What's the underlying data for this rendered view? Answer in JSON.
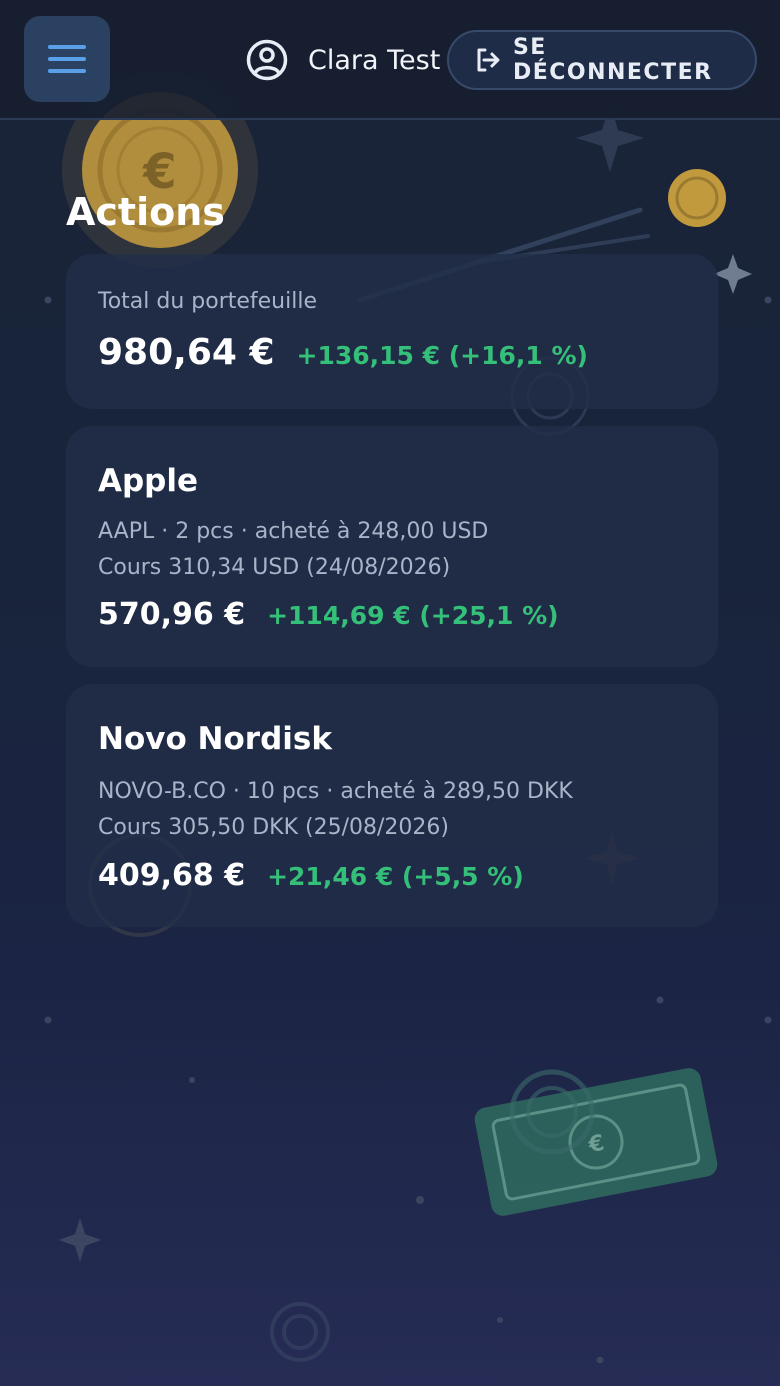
{
  "header": {
    "user_name": "Clara Test",
    "logout_label": "SE DÉCONNECTER"
  },
  "page": {
    "title": "Actions"
  },
  "portfolio": {
    "total_label": "Total du portefeuille",
    "total_value": "980,64 €",
    "total_change": "+136,15 € (+16,1 %)"
  },
  "holdings": [
    {
      "name": "Apple",
      "details": "AAPL · 2 pcs · acheté à 248,00 USD",
      "price": "Cours 310,34 USD (24/08/2026)",
      "value": "570,96 €",
      "change": "+114,69 € (+25,1 %)"
    },
    {
      "name": "Novo Nordisk",
      "details": "NOVO-B.CO · 10 pcs · acheté à 289,50 DKK",
      "price": "Cours 305,50 DKK (25/08/2026)",
      "value": "409,68 €",
      "change": "+21,46 € (+5,5 %)"
    }
  ],
  "colors": {
    "background": "#1a2438",
    "card": "#222e48",
    "gain": "#35c07a",
    "accent": "#5aa0e8",
    "coin": "#d4a847",
    "banknote": "#2f6b5e"
  },
  "icons": {
    "menu": "hamburger-icon",
    "user": "user-circle-icon",
    "logout": "logout-icon"
  }
}
